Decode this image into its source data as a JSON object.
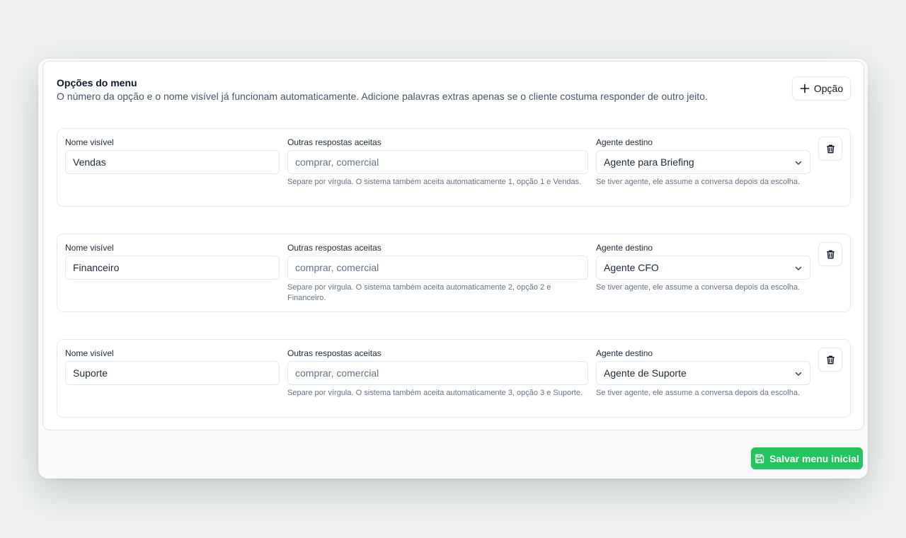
{
  "section": {
    "title": "Opções do menu",
    "description": "O número da opção e o nome visível já funcionam automaticamente. Adicione palavras extras apenas se o cliente costuma responder de outro jeito.",
    "add_button_label": "Opção"
  },
  "labels": {
    "name": "Nome visível",
    "aliases": "Outras respostas aceitas",
    "agent": "Agente destino"
  },
  "options": [
    {
      "name": "Vendas",
      "aliases_placeholder": "comprar, comercial",
      "aliases_help": "Separe por vírgula. O sistema também aceita automaticamente 1, opção 1 e Vendas.",
      "agent": "Agente para Briefing",
      "agent_help": "Se tiver agente, ele assume a conversa depois da escolha."
    },
    {
      "name": "Financeiro",
      "aliases_placeholder": "comprar, comercial",
      "aliases_help": "Separe por vírgula. O sistema também aceita automaticamente 2, opção 2 e Financeiro.",
      "agent": "Agente CFO",
      "agent_help": "Se tiver agente, ele assume a conversa depois da escolha."
    },
    {
      "name": "Suporte",
      "aliases_placeholder": "comprar, comercial",
      "aliases_help": "Separe por vírgula. O sistema também aceita automaticamente 3, opção 3 e Suporte.",
      "agent": "Agente de Suporte",
      "agent_help": "Se tiver agente, ele assume a conversa depois da escolha."
    }
  ],
  "footer": {
    "save_label": "Salvar menu inicial"
  },
  "icons": {
    "add": "plus-icon",
    "delete": "trash-icon",
    "select": "chevron-down-icon",
    "save": "save-icon"
  },
  "colors": {
    "primary": "#22c55e"
  }
}
